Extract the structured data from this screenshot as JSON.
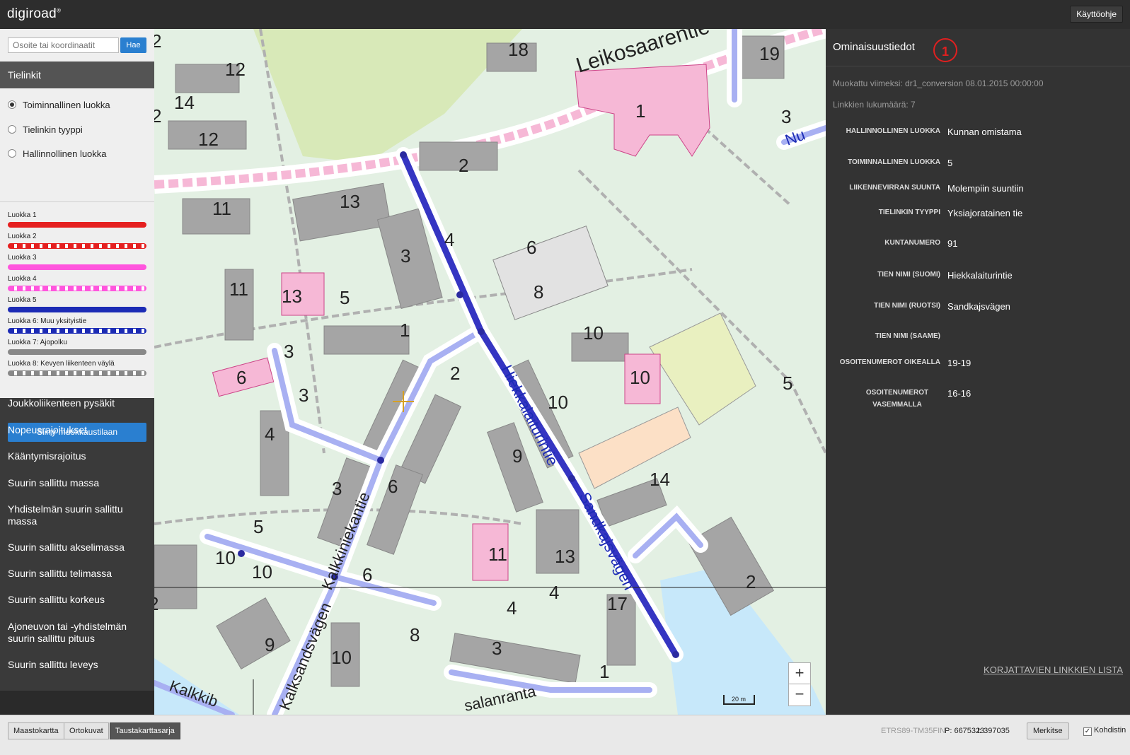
{
  "app": {
    "logo": "digiroad",
    "logo_mark": "®",
    "help_button": "Käyttöohje"
  },
  "search": {
    "placeholder": "Osoite tai koordinaatit",
    "button": "Hae"
  },
  "tielinkit": {
    "header": "Tielinkit",
    "radios": [
      {
        "label": "Toiminnallinen luokka",
        "checked": true
      },
      {
        "label": "Tielinkin tyyppi",
        "checked": false
      },
      {
        "label": "Hallinnollinen luokka",
        "checked": false
      }
    ],
    "legend": [
      {
        "label": "Luokka 1",
        "color": "#e52020",
        "dashed": false
      },
      {
        "label": "Luokka 2",
        "color": "#e52020",
        "dashed": true
      },
      {
        "label": "Luokka 3",
        "color": "#ff55dd",
        "dashed": false
      },
      {
        "label": "Luokka 4",
        "color": "#ff55dd",
        "dashed": true
      },
      {
        "label": "Luokka 5",
        "color": "#1c2bb5",
        "dashed": false
      },
      {
        "label": "Luokka 6: Muu yksityistie",
        "color": "#1c2bb5",
        "dashed": true
      },
      {
        "label": "Luokka 7: Ajopolku",
        "color": "#888888",
        "dashed": false
      },
      {
        "label": "Luokka 8: Kevyen liikenteen väylä",
        "color": "#888888",
        "dashed": true
      }
    ],
    "edit_button": "Siirry muokkaustilaan"
  },
  "nav": [
    "Joukkoliikenteen pysäkit",
    "Nopeusrajoitukset",
    "Kääntymisrajoitus",
    "Suurin sallittu massa",
    "Yhdistelmän suurin sallittu massa",
    "Suurin sallittu akselimassa",
    "Suurin sallittu telimassa",
    "Suurin sallittu korkeus",
    "Ajoneuvon tai -yhdistelmän suurin sallittu pituus",
    "Suurin sallittu leveys"
  ],
  "map": {
    "streets": {
      "leikosaarentie": "Leikosaarentie",
      "hiekkalaiturintie": "Hiekkalaiturintie",
      "sandkajsvagen": "Sandkajsvägen",
      "kalkkiniekantie": "Kalkkiniekantie",
      "kalksandsvagen": "Kalksandsvägen",
      "kalkkib": "Kalkkib",
      "salanranta": "salanranta",
      "nu": "Nu"
    },
    "house_numbers": [
      "2",
      "12",
      "14",
      "2",
      "12",
      "18",
      "1",
      "19",
      "3",
      "2",
      "13",
      "11",
      "4",
      "3",
      "6",
      "8",
      "11",
      "13",
      "5",
      "1",
      "3",
      "10",
      "10",
      "10",
      "6",
      "3",
      "2",
      "4",
      "9",
      "5",
      "6",
      "3",
      "5",
      "10",
      "10",
      "11",
      "13",
      "14",
      "6",
      "4",
      "4",
      "17",
      "2",
      "2",
      "9",
      "8",
      "10",
      "3",
      "1"
    ],
    "scale_label": "20 m",
    "zoom_in": "+",
    "zoom_out": "−",
    "colors": {
      "route_main": "#3535c2",
      "route_light": "#a8b0f2",
      "building": "#a5a5a5",
      "building_pink": "#f6b8d6",
      "water": "#c7e8fa"
    }
  },
  "properties": {
    "title": "Ominaisuustiedot",
    "badge": "1",
    "modified": "Muokattu viimeksi: dr1_conversion 08.01.2015 00:00:00",
    "link_count": "Linkkien lukumäärä: 7",
    "rows": [
      {
        "label": "HALLINNOLLINEN LUOKKA",
        "value": "Kunnan omistama"
      },
      {
        "label": "TOIMINNALLINEN LUOKKA",
        "value": "5"
      },
      {
        "label": "LIIKENNEVIRRAN SUUNTA",
        "value": "Molempiin suuntiin"
      },
      {
        "label": "TIELINKIN TYYPPI",
        "value": "Yksiajoratainen tie"
      },
      {
        "label": "KUNTANUMERO",
        "value": "91"
      },
      {
        "label": "TIEN NIMI (SUOMI)",
        "value": "Hiekkalaiturintie"
      },
      {
        "label": "TIEN NIMI (RUOTSI)",
        "value": "Sandkajsvägen"
      },
      {
        "label": "TIEN NIMI (SAAME)",
        "value": ""
      },
      {
        "label": "OSOITENUMEROT OIKEALLA",
        "value": "19-19"
      },
      {
        "label": "OSOITENUMEROT VASEMMALLA",
        "value": "16-16"
      }
    ],
    "fix_link": "KORJATTAVIEN LINKKIEN LISTA"
  },
  "bottom": {
    "background_buttons": [
      {
        "label": "Maastokartta",
        "active": false
      },
      {
        "label": "Ortokuvat",
        "active": false
      },
      {
        "label": "Taustakarttasarja",
        "active": true
      }
    ],
    "crs": "ETRS89-TM35FIN",
    "coord_p": "P: 6675323",
    "coord_i": "I: 397035",
    "mark_button": "Merkitse",
    "kohdistin": "Kohdistin",
    "kohdistin_checked": true
  }
}
